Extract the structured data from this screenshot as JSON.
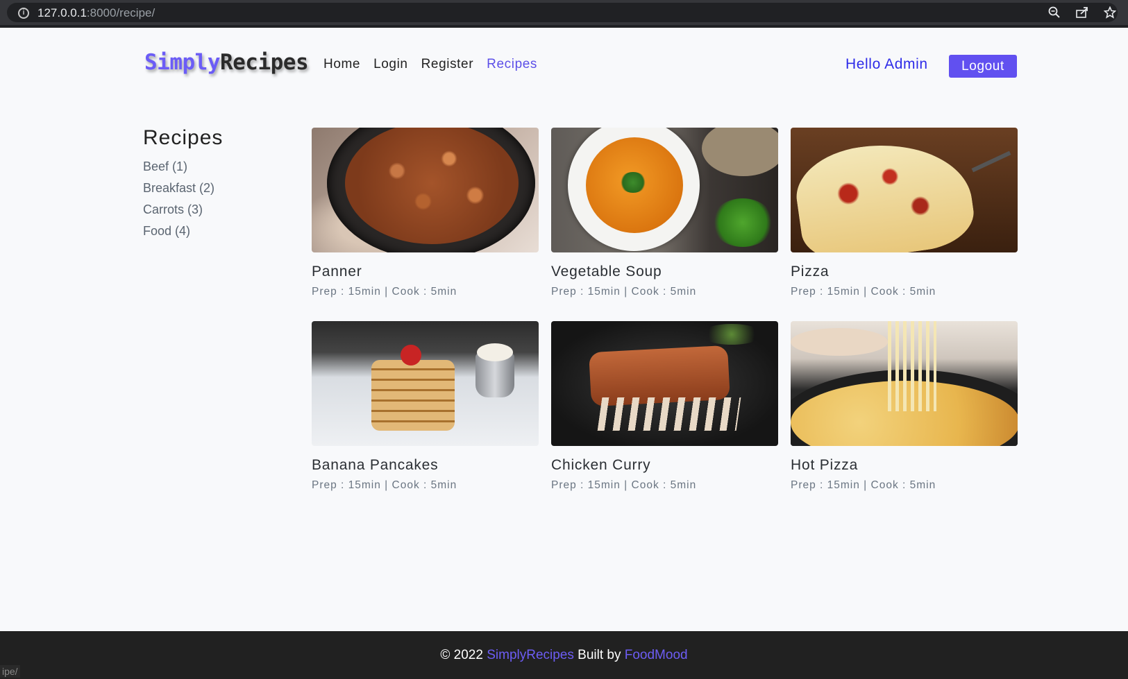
{
  "browser": {
    "url_host": "127.0.0.1",
    "url_path": ":8000/recipe/",
    "icons": [
      "info-icon",
      "zoom-icon",
      "share-icon",
      "bookmark-star-icon"
    ],
    "status_text": "ipe/"
  },
  "navbar": {
    "brand_part1": "Simply",
    "brand_part2": "Recipes",
    "links": [
      {
        "label": "Home",
        "active": false
      },
      {
        "label": "Login",
        "active": false
      },
      {
        "label": "Register",
        "active": false
      },
      {
        "label": "Recipes",
        "active": true
      }
    ],
    "greeting": "Hello Admin",
    "logout_label": "Logout",
    "accent_color": "#6150f0"
  },
  "sidebar": {
    "title": "Recipes",
    "categories": [
      {
        "label": "Beef (1)"
      },
      {
        "label": "Breakfast (2)"
      },
      {
        "label": "Carrots (3)"
      },
      {
        "label": "Food (4)"
      }
    ]
  },
  "recipes": [
    {
      "title": "Panner",
      "meta": "Prep : 15min | Cook : 5min",
      "image": "panner-photo"
    },
    {
      "title": "Vegetable Soup",
      "meta": "Prep : 15min | Cook : 5min",
      "image": "soup-photo"
    },
    {
      "title": "Pizza",
      "meta": "Prep : 15min | Cook : 5min",
      "image": "pizza-photo"
    },
    {
      "title": "Banana Pancakes",
      "meta": "Prep : 15min | Cook : 5min",
      "image": "pancakes-photo"
    },
    {
      "title": "Chicken Curry",
      "meta": "Prep : 15min | Cook : 5min",
      "image": "ribs-photo"
    },
    {
      "title": "Hot Pizza",
      "meta": "Prep : 15min | Cook : 5min",
      "image": "cheese-pizza-photo"
    }
  ],
  "footer": {
    "prefix": "© 2022 ",
    "brand_link": "SimplyRecipes",
    "middle": " Built by ",
    "author_link": "FoodMood"
  }
}
